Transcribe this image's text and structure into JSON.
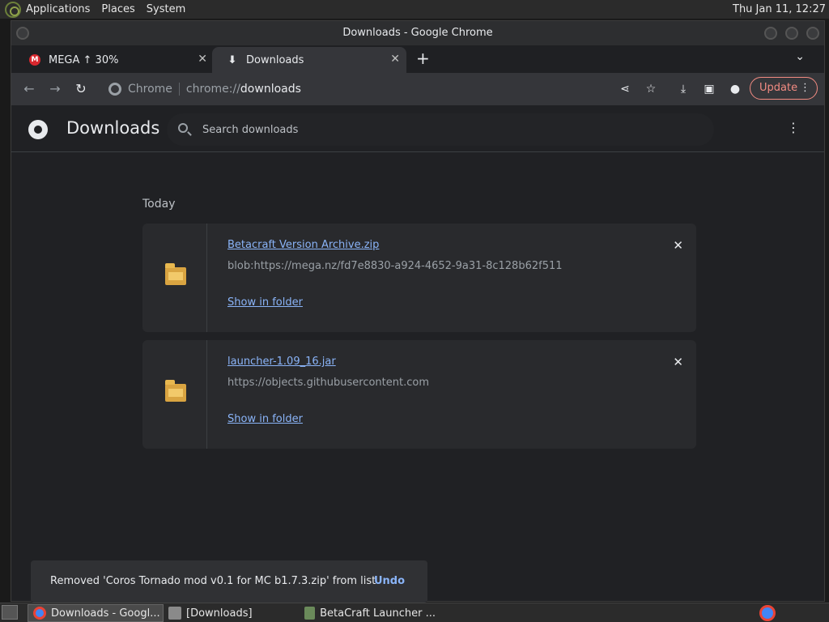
{
  "top_panel": {
    "menus": [
      "Applications",
      "Places",
      "System"
    ],
    "clock": "Thu Jan 11, 12:27"
  },
  "window": {
    "title": "Downloads - Google Chrome"
  },
  "tabs": [
    {
      "label": "MEGA ↑ 30%",
      "icon": "mega-icon"
    },
    {
      "label": "Downloads",
      "icon": "download-icon"
    }
  ],
  "toolbar": {
    "omnibox_site": "Chrome",
    "omnibox_scheme": "chrome://",
    "omnibox_path": "downloads",
    "update_label": "Update"
  },
  "page": {
    "title": "Downloads",
    "search_placeholder": "Search downloads",
    "section_date": "Today",
    "downloads": [
      {
        "filename": "Betacraft Version Archive.zip",
        "url": "blob:https://mega.nz/fd7e8830-a924-4652-9a31-8c128b62f511",
        "action": "Show in folder"
      },
      {
        "filename": "launcher-1.09_16.jar",
        "url": "https://objects.githubusercontent.com",
        "action": "Show in folder"
      }
    ],
    "toast": {
      "message": "Removed 'Coros Tornado mod v0.1 for MC b1.7.3.zip' from list",
      "action": "Undo"
    }
  },
  "taskbar": {
    "tasks": [
      {
        "label": "Downloads - Googl...",
        "active": true
      },
      {
        "label": "[Downloads]",
        "active": false
      },
      {
        "label": "BetaCraft Launcher ...",
        "active": false
      }
    ]
  },
  "colors": {
    "link": "#8ab4f8",
    "update_accent": "#f28b82",
    "page_bg": "#202124"
  }
}
